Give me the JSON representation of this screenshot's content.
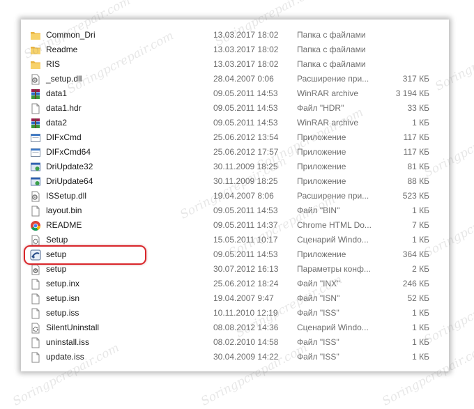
{
  "files": [
    {
      "name": "Common_Dri",
      "date": "13.03.2017 18:02",
      "type": "Папка с файлами",
      "size": "",
      "icon": "folder-icon"
    },
    {
      "name": "Readme",
      "date": "13.03.2017 18:02",
      "type": "Папка с файлами",
      "size": "",
      "icon": "folder-icon"
    },
    {
      "name": "RIS",
      "date": "13.03.2017 18:02",
      "type": "Папка с файлами",
      "size": "",
      "icon": "folder-icon"
    },
    {
      "name": "_setup.dll",
      "date": "28.04.2007 0:06",
      "type": "Расширение при...",
      "size": "317 КБ",
      "icon": "dll-file-icon"
    },
    {
      "name": "data1",
      "date": "09.05.2011 14:53",
      "type": "WinRAR archive",
      "size": "3 194 КБ",
      "icon": "winrar-archive-icon"
    },
    {
      "name": "data1.hdr",
      "date": "09.05.2011 14:53",
      "type": "Файл \"HDR\"",
      "size": "33 КБ",
      "icon": "blank-file-icon"
    },
    {
      "name": "data2",
      "date": "09.05.2011 14:53",
      "type": "WinRAR archive",
      "size": "1 КБ",
      "icon": "winrar-archive-icon"
    },
    {
      "name": "DIFxCmd",
      "date": "25.06.2012 13:54",
      "type": "Приложение",
      "size": "117 КБ",
      "icon": "application-icon"
    },
    {
      "name": "DIFxCmd64",
      "date": "25.06.2012 17:57",
      "type": "Приложение",
      "size": "117 КБ",
      "icon": "application-icon"
    },
    {
      "name": "DriUpdate32",
      "date": "30.11.2009 18:25",
      "type": "Приложение",
      "size": "81 КБ",
      "icon": "driver-update-icon"
    },
    {
      "name": "DriUpdate64",
      "date": "30.11.2009 18:25",
      "type": "Приложение",
      "size": "88 КБ",
      "icon": "driver-update-icon"
    },
    {
      "name": "ISSetup.dll",
      "date": "19.04.2007 8:06",
      "type": "Расширение при...",
      "size": "523 КБ",
      "icon": "dll-file-icon"
    },
    {
      "name": "layout.bin",
      "date": "09.05.2011 14:53",
      "type": "Файл \"BIN\"",
      "size": "1 КБ",
      "icon": "blank-file-icon"
    },
    {
      "name": "README",
      "date": "09.05.2011 14:37",
      "type": "Chrome HTML Do...",
      "size": "7 КБ",
      "icon": "chrome-icon"
    },
    {
      "name": "Setup",
      "date": "15.05.2011 10:17",
      "type": "Сценарий Windo...",
      "size": "1 КБ",
      "icon": "script-file-icon"
    },
    {
      "name": "setup",
      "date": "09.05.2011 14:53",
      "type": "Приложение",
      "size": "364 КБ",
      "icon": "setup-installer-icon"
    },
    {
      "name": "setup",
      "date": "30.07.2012 16:13",
      "type": "Параметры конф...",
      "size": "2 КБ",
      "icon": "config-file-icon"
    },
    {
      "name": "setup.inx",
      "date": "25.06.2012 18:24",
      "type": "Файл \"INX\"",
      "size": "246 КБ",
      "icon": "blank-file-icon"
    },
    {
      "name": "setup.isn",
      "date": "19.04.2007 9:47",
      "type": "Файл \"ISN\"",
      "size": "52 КБ",
      "icon": "blank-file-icon"
    },
    {
      "name": "setup.iss",
      "date": "10.11.2010 12:19",
      "type": "Файл \"ISS\"",
      "size": "1 КБ",
      "icon": "blank-file-icon"
    },
    {
      "name": "SilentUninstall",
      "date": "08.08.2012 14:36",
      "type": "Сценарий Windo...",
      "size": "1 КБ",
      "icon": "script-file-icon"
    },
    {
      "name": "uninstall.iss",
      "date": "08.02.2010 14:58",
      "type": "Файл \"ISS\"",
      "size": "1 КБ",
      "icon": "blank-file-icon"
    },
    {
      "name": "update.iss",
      "date": "30.04.2009 14:22",
      "type": "Файл \"ISS\"",
      "size": "1 КБ",
      "icon": "blank-file-icon"
    }
  ],
  "watermark": "Soringpcrepair.com",
  "colors": {
    "highlight": "#d9262b",
    "folder": "#f3c659",
    "text": "#1a1a1a",
    "muted": "#6d6d6d"
  }
}
